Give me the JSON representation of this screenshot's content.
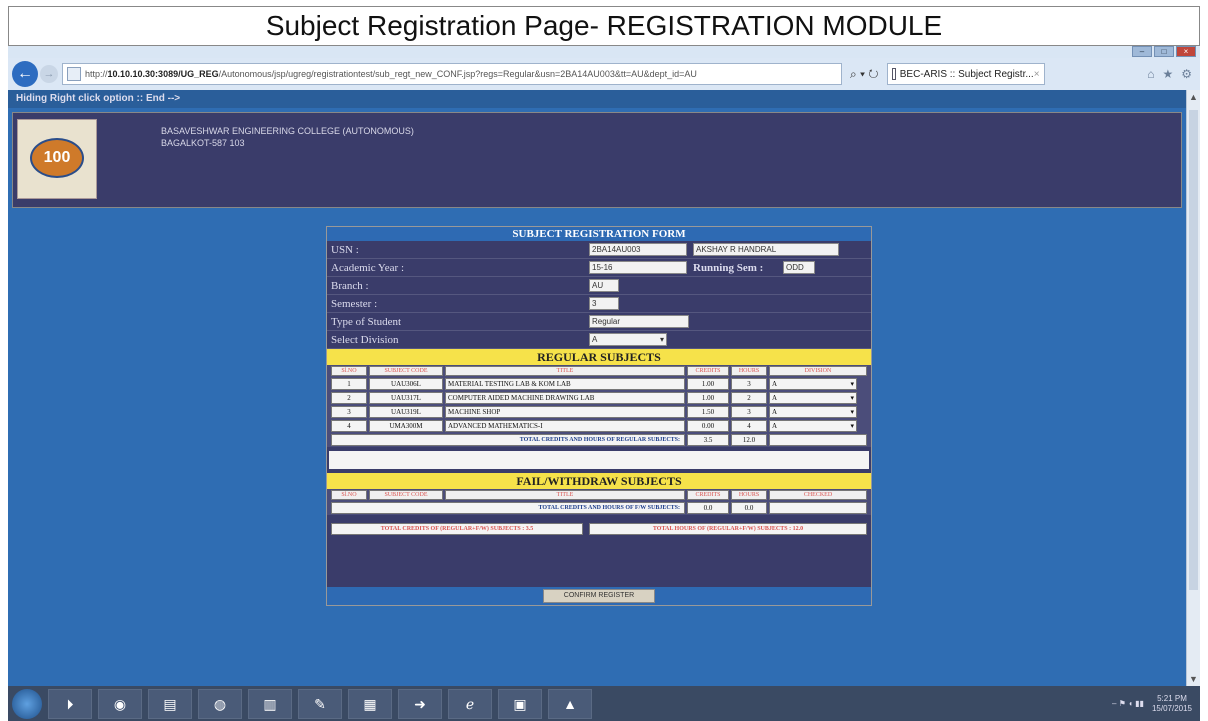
{
  "page_title": "Subject Registration Page- REGISTRATION MODULE",
  "browser": {
    "url_prefix": "http://",
    "url_host": "10.10.10.30:3089/UG_REG",
    "url_rest": "/Autonomous/jsp/ugreg/registrationtest/sub_regt_new_CONF.jsp?regs=Regular&usn=2BA14AU003&tt=AU&dept_id=AU",
    "tab_title": "BEC-ARIS :: Subject Registr...",
    "tab_close": "×",
    "search_tools": "⌕ ▾ ↻",
    "home_icons": [
      "⌂",
      "★",
      "⚙"
    ],
    "back": "←",
    "forward": "→"
  },
  "link_bar": "Hiding Right click option :: End -->",
  "college": {
    "line1": "BASAVESHWAR ENGINEERING COLLEGE (AUTONOMOUS)",
    "line2": "BAGALKOT-587 103",
    "logo_number": "100"
  },
  "form": {
    "title": "SUBJECT REGISTRATION FORM",
    "usn_label": "USN :",
    "usn": "2BA14AU003",
    "student_name": "AKSHAY R HANDRAL",
    "year_label": "Academic Year :",
    "year": "15-16",
    "running_sem_label": "Running Sem :",
    "running_sem": "ODD",
    "branch_label": "Branch :",
    "branch": "AU",
    "semester_label": "Semester :",
    "semester": "3",
    "type_label": "Type of Student",
    "type": "Regular",
    "division_label": "Select Division",
    "division": "A"
  },
  "regular": {
    "heading": "REGULAR SUBJECTS",
    "columns": [
      "Sl.NO",
      "SUBJECT CODE",
      "TITLE",
      "CREDITS",
      "HOURS",
      "DIVISION"
    ],
    "rows": [
      {
        "no": "1",
        "code": "UAU306L",
        "title": "MATERIAL TESTING LAB & KOM LAB",
        "credits": "1.00",
        "hours": "3",
        "division": "A"
      },
      {
        "no": "2",
        "code": "UAU317L",
        "title": "COMPUTER AIDED MACHINE DRAWING LAB",
        "credits": "1.00",
        "hours": "2",
        "division": "A"
      },
      {
        "no": "3",
        "code": "UAU319L",
        "title": "MACHINE SHOP",
        "credits": "1.50",
        "hours": "3",
        "division": "A"
      },
      {
        "no": "4",
        "code": "UMA300M",
        "title": "ADVANCED MATHEMATICS-I",
        "credits": "0.00",
        "hours": "4",
        "division": "A"
      }
    ],
    "total_label": "TOTAL CREDITS AND HOURS OF REGULAR SUBJECTS:",
    "total_credits": "3.5",
    "total_hours": "12.0"
  },
  "fail": {
    "heading": "FAIL/WITHDRAW SUBJECTS",
    "columns": [
      "Sl.NO",
      "SUBJECT CODE",
      "TITLE",
      "CREDITS",
      "HOURS",
      "CHECKED"
    ],
    "total_label": "TOTAL CREDITS AND HOURS OF F/W SUBJECTS:",
    "total_credits": "0.0",
    "total_hours": "0.0"
  },
  "grand": {
    "credits": "TOTAL CREDITS OF (REGULAR+F/W) SUBJECTS : 3.5",
    "hours": "TOTAL HOURS OF (REGULAR+F/W) SUBJECTS : 12.0"
  },
  "confirm_label": "CONFIRM REGISTER",
  "taskbar": {
    "items": [
      "⏵",
      "◉",
      "▤",
      "◍",
      "▥",
      "✎",
      "▦",
      "➜",
      "ℯ",
      "▣",
      "▲"
    ],
    "tray": "– ⚑ ◖ ▮▮",
    "time": "5:21 PM",
    "date": "15/07/2015"
  }
}
